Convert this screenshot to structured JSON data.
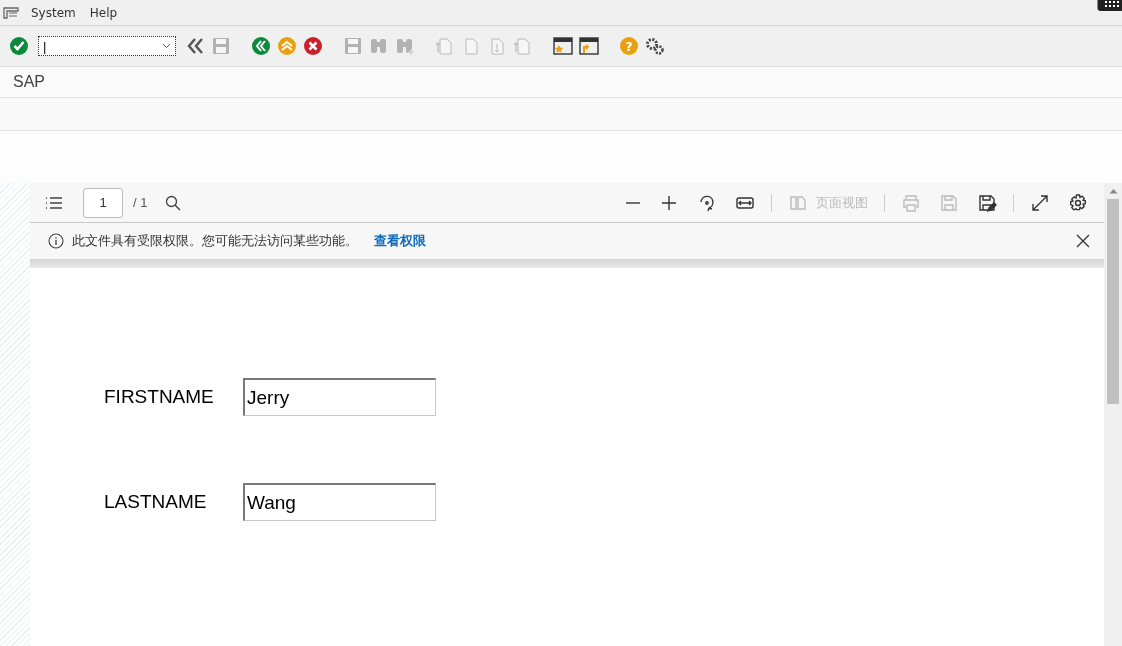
{
  "menu_bar": {
    "items": [
      {
        "label": "System"
      },
      {
        "label": "Help"
      }
    ]
  },
  "toolbar": {
    "command_field": {
      "value": "|"
    },
    "buttons": [
      {
        "kind": "enter",
        "disabled": false
      },
      {
        "kind": "field"
      },
      {
        "kind": "history",
        "disabled": false
      },
      {
        "kind": "save",
        "disabled": true
      },
      {
        "kind": "back",
        "disabled": false
      },
      {
        "kind": "exit",
        "disabled": false
      },
      {
        "kind": "cancel",
        "disabled": false
      },
      {
        "kind": "print",
        "disabled": true
      },
      {
        "kind": "find",
        "disabled": true
      },
      {
        "kind": "find_next",
        "disabled": true
      },
      {
        "kind": "first_page",
        "disabled": true
      },
      {
        "kind": "prev_page",
        "disabled": true
      },
      {
        "kind": "next_page",
        "disabled": true
      },
      {
        "kind": "last_page",
        "disabled": true
      },
      {
        "kind": "new_session",
        "disabled": false
      },
      {
        "kind": "shortcut",
        "disabled": false
      },
      {
        "kind": "help",
        "glyph": "?",
        "disabled": false
      },
      {
        "kind": "settings",
        "disabled": false
      }
    ]
  },
  "title_bar": {
    "title": "SAP"
  },
  "pdf_viewer": {
    "toolbar": {
      "page_input": "1",
      "page_count": "/ 1",
      "right_buttons": [
        {
          "kind": "zoom_out",
          "disabled": false
        },
        {
          "kind": "zoom_in",
          "disabled": false
        },
        {
          "kind": "rotate",
          "disabled": false
        },
        {
          "kind": "fit_width",
          "disabled": false
        },
        {
          "kind": "page_view",
          "label": "页面视图",
          "disabled": true
        },
        {
          "kind": "print",
          "disabled": true
        },
        {
          "kind": "save",
          "disabled": true
        },
        {
          "kind": "save_as",
          "disabled": false
        },
        {
          "kind": "fullscreen",
          "disabled": false
        },
        {
          "kind": "settings",
          "disabled": false
        }
      ]
    },
    "info_bar": {
      "message": "此文件具有受限权限。您可能无法访问某些功能。",
      "link": "查看权限"
    },
    "form": {
      "fields": [
        {
          "label": "FIRSTNAME",
          "value": "Jerry"
        },
        {
          "label": "LASTNAME",
          "value": "Wang"
        }
      ]
    }
  }
}
